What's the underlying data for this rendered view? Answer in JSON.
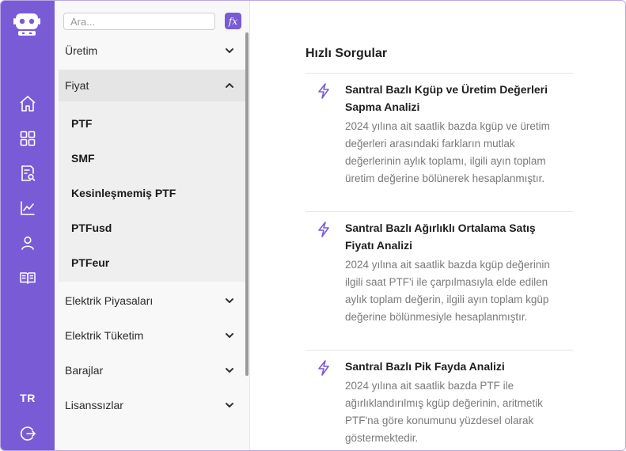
{
  "rail": {
    "logo_icon": "robot-icon",
    "nav_icons": [
      "home-icon",
      "dashboard-icon",
      "report-search-icon",
      "chart-line-icon",
      "user-icon",
      "book-icon"
    ],
    "language": "TR",
    "logout_icon": "logout-icon",
    "color": "#7a5bd6"
  },
  "sidebar": {
    "search_placeholder": "Ara...",
    "fx_label": "fx",
    "items": [
      {
        "label": "Üretim",
        "expanded": false
      },
      {
        "label": "Fiyat",
        "expanded": true
      },
      {
        "label": "Elektrik Piyasaları",
        "expanded": false
      },
      {
        "label": "Elektrik Tüketim",
        "expanded": false
      },
      {
        "label": "Barajlar",
        "expanded": false
      },
      {
        "label": "Lisanssızlar",
        "expanded": false
      }
    ],
    "fiyat_sub": [
      "PTF",
      "SMF",
      "Kesinleşmemiş PTF",
      "PTFusd",
      "PTFeur"
    ]
  },
  "main": {
    "title": "Hızlı Sorgular",
    "queries": [
      {
        "title": "Santral Bazlı Kgüp ve Üretim Değerleri Sapma Analizi",
        "desc": "2024 yılına ait saatlik bazda kgüp ve üretim değerleri arasındaki farkların mutlak değerlerinin aylık toplamı, ilgili ayın toplam üretim değerine bölünerek hesaplanmıştır."
      },
      {
        "title": "Santral Bazlı Ağırlıklı Ortalama Satış Fiyatı Analizi",
        "desc": "2024 yılına ait saatlik bazda kgüp değerinin ilgili saat PTF'i ile çarpılmasıyla elde edilen aylık toplam değerin, ilgili ayın toplam kgüp değerine bölünmesiyle hesaplanmıştır."
      },
      {
        "title": "Santral Bazlı Pik Fayda Analizi",
        "desc": "2024 yılına ait saatlik bazda PTF ile ağırlıklandırılmış kgüp değerinin, aritmetik PTF'na göre konumunu yüzdesel olarak göstermektedir."
      }
    ],
    "bolt_icon": "lightning-icon"
  }
}
